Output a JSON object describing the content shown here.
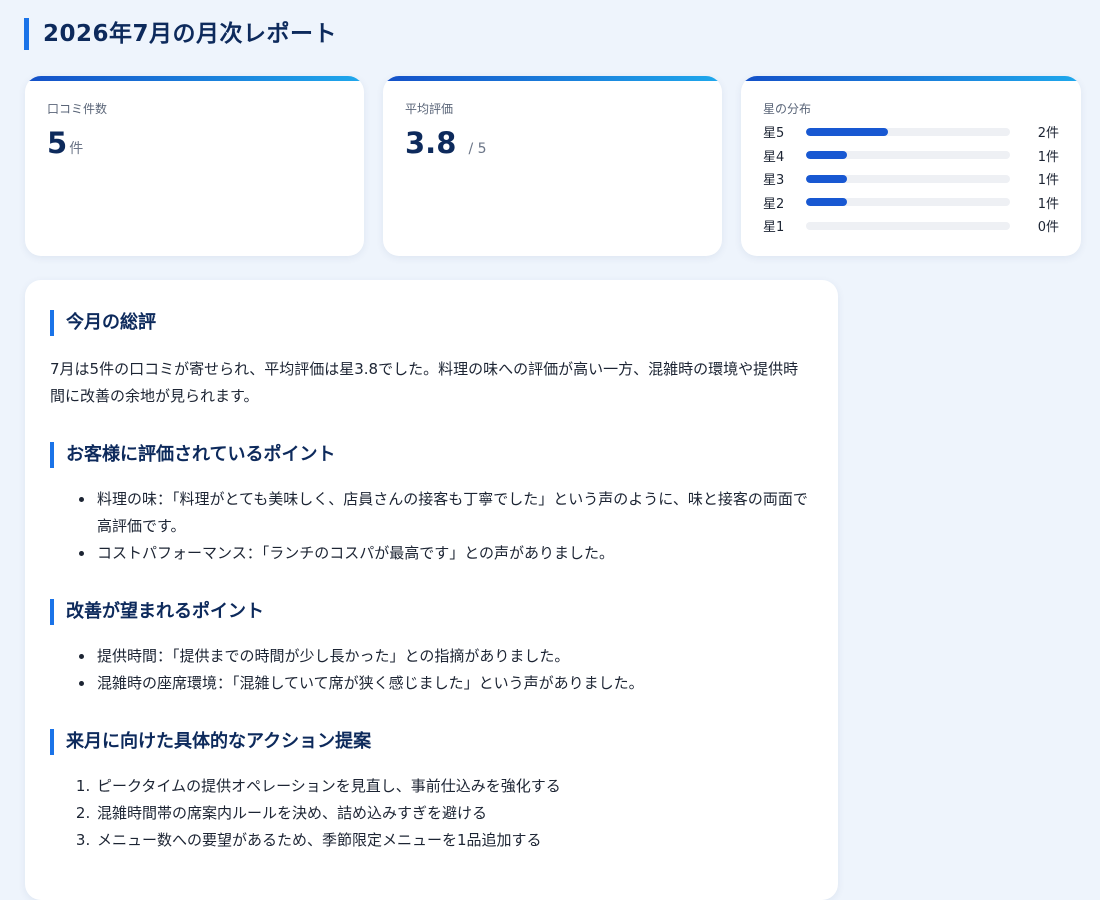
{
  "page": {
    "title": "2026年7月の月次レポート"
  },
  "stats": {
    "review_count": {
      "label": "口コミ件数",
      "value": "5",
      "unit": "件"
    },
    "average_rating": {
      "label": "平均評価",
      "value": "3.8",
      "unit": "/ 5"
    },
    "distribution": {
      "label": "星の分布",
      "rows": [
        {
          "label": "星5",
          "count": "2件",
          "fraction": 0.4
        },
        {
          "label": "星4",
          "count": "1件",
          "fraction": 0.2
        },
        {
          "label": "星3",
          "count": "1件",
          "fraction": 0.2
        },
        {
          "label": "星2",
          "count": "1件",
          "fraction": 0.2
        },
        {
          "label": "星1",
          "count": "0件",
          "fraction": 0.0
        }
      ]
    }
  },
  "colors": {
    "accent": "#1a73e8",
    "bar_fill": "#1858d2",
    "heading": "#0d2a5c"
  },
  "report": {
    "summary": {
      "heading": "今月の総評",
      "text": "7月は5件の口コミが寄せられ、平均評価は星3.8でした。料理の味への評価が高い一方、混雑時の環境や提供時間に改善の余地が見られます。"
    },
    "strengths": {
      "heading": "お客様に評価されているポイント",
      "items": [
        "料理の味：「料理がとても美味しく、店員さんの接客も丁寧でした」という声のように、味と接客の両面で高評価です。",
        "コストパフォーマンス：「ランチのコスパが最高です」との声がありました。"
      ]
    },
    "improvements": {
      "heading": "改善が望まれるポイント",
      "items": [
        "提供時間：「提供までの時間が少し長かった」との指摘がありました。",
        "混雑時の座席環境：「混雑していて席が狭く感じました」という声がありました。"
      ]
    },
    "actions": {
      "heading": "来月に向けた具体的なアクション提案",
      "items": [
        "ピークタイムの提供オペレーションを見直し、事前仕込みを強化する",
        "混雑時間帯の席案内ルールを決め、詰め込みすぎを避ける",
        "メニュー数への要望があるため、季節限定メニューを1品追加する"
      ]
    }
  }
}
